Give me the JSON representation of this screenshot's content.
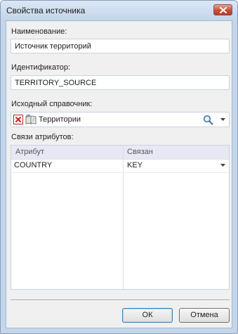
{
  "window": {
    "title": "Свойства источника",
    "close_icon": "close-x-icon"
  },
  "fields": {
    "name_label": "Наименование:",
    "name_value": "Источник территорий",
    "id_label": "Идентификатор:",
    "id_value": "TERRITORY_SOURCE",
    "source_label": "Исходный справочник:",
    "source_value": "Территории",
    "source_icons": [
      "clear-x-icon",
      "book-icon",
      "search-icon",
      "chevron-down-icon"
    ]
  },
  "attributes": {
    "label": "Связи атрибутов:",
    "columns": [
      "Атрибут",
      "Связан"
    ],
    "rows": [
      {
        "attribute": "COUNTRY",
        "linked": "KEY"
      }
    ]
  },
  "buttons": {
    "ok": "ОК",
    "cancel": "Отмена"
  },
  "colors": {
    "frame": "#c4d6ea",
    "client_bg": "#f0f0f0",
    "grid_header_bg": "#e8e8f5",
    "close_button": "#c8503a",
    "clear_icon": "#d22020"
  }
}
